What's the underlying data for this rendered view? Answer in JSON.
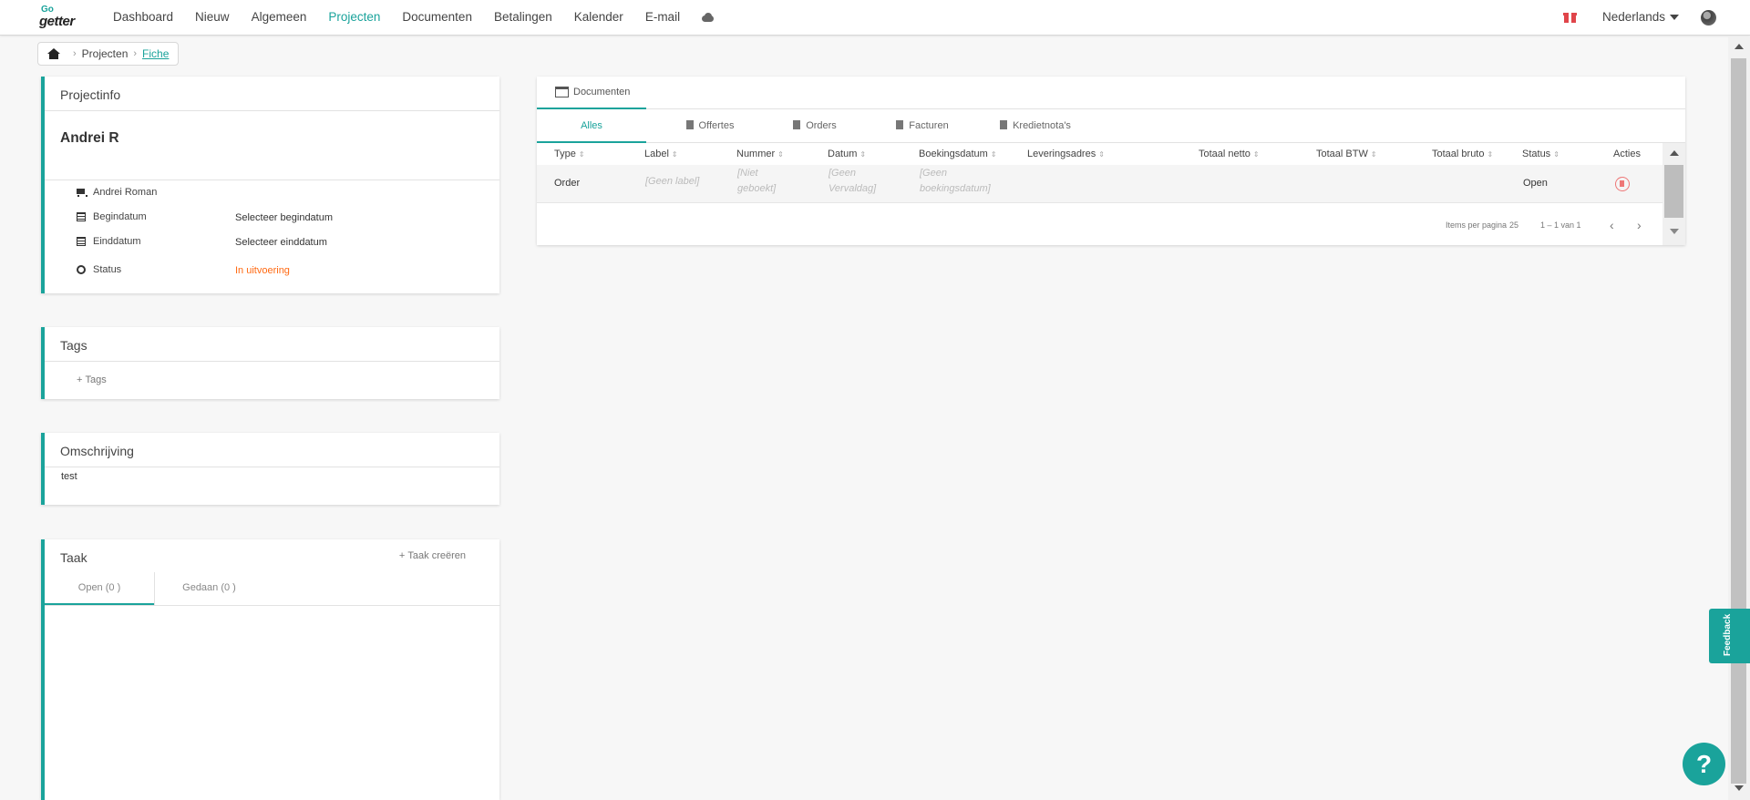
{
  "nav": {
    "logo_top": "Go",
    "logo_bottom": "getter",
    "items": [
      "Dashboard",
      "Nieuw",
      "Algemeen",
      "Projecten",
      "Documenten",
      "Betalingen",
      "Kalender",
      "E-mail"
    ],
    "active": "Projecten",
    "language": "Nederlands",
    "accent_color": "#1aa39b"
  },
  "breadcrumb": {
    "items": [
      "Projecten",
      "Fiche"
    ]
  },
  "projectinfo": {
    "title": "Projectinfo",
    "name": "Andrei R",
    "customer": "Andrei Roman",
    "start_label": "Begindatum",
    "start_value": "Selecteer begindatum",
    "end_label": "Einddatum",
    "end_value": "Selecteer einddatum",
    "status_label": "Status",
    "status_value": "In uitvoering"
  },
  "tags": {
    "title": "Tags",
    "add_label": "Tags"
  },
  "description": {
    "title": "Omschrijving",
    "text": "test"
  },
  "task": {
    "title": "Taak",
    "create_label": "Taak creëren",
    "tabs": [
      "Open (0 )",
      "Gedaan (0 )"
    ]
  },
  "documents": {
    "tab_label": "Documenten",
    "filters": [
      "Alles",
      "Offertes",
      "Orders",
      "Facturen",
      "Kredietnota's"
    ],
    "columns": [
      "Type",
      "Label",
      "Nummer",
      "Datum",
      "Boekingsdatum",
      "Leveringsadres",
      "Totaal netto",
      "Totaal BTW",
      "Totaal bruto",
      "Status",
      "Acties"
    ],
    "row": {
      "type": "Order",
      "label": "[Geen label]",
      "nummer": "[Niet geboekt]",
      "datum": "[Geen Vervaldag]",
      "boekingsdatum": "[Geen boekingsdatum]",
      "status": "Open"
    },
    "items_per_page_label": "Items per pagina",
    "items_per_page": "25",
    "range": "1 – 1 van 1"
  },
  "feedback_label": "Feedback",
  "help_label": "?"
}
